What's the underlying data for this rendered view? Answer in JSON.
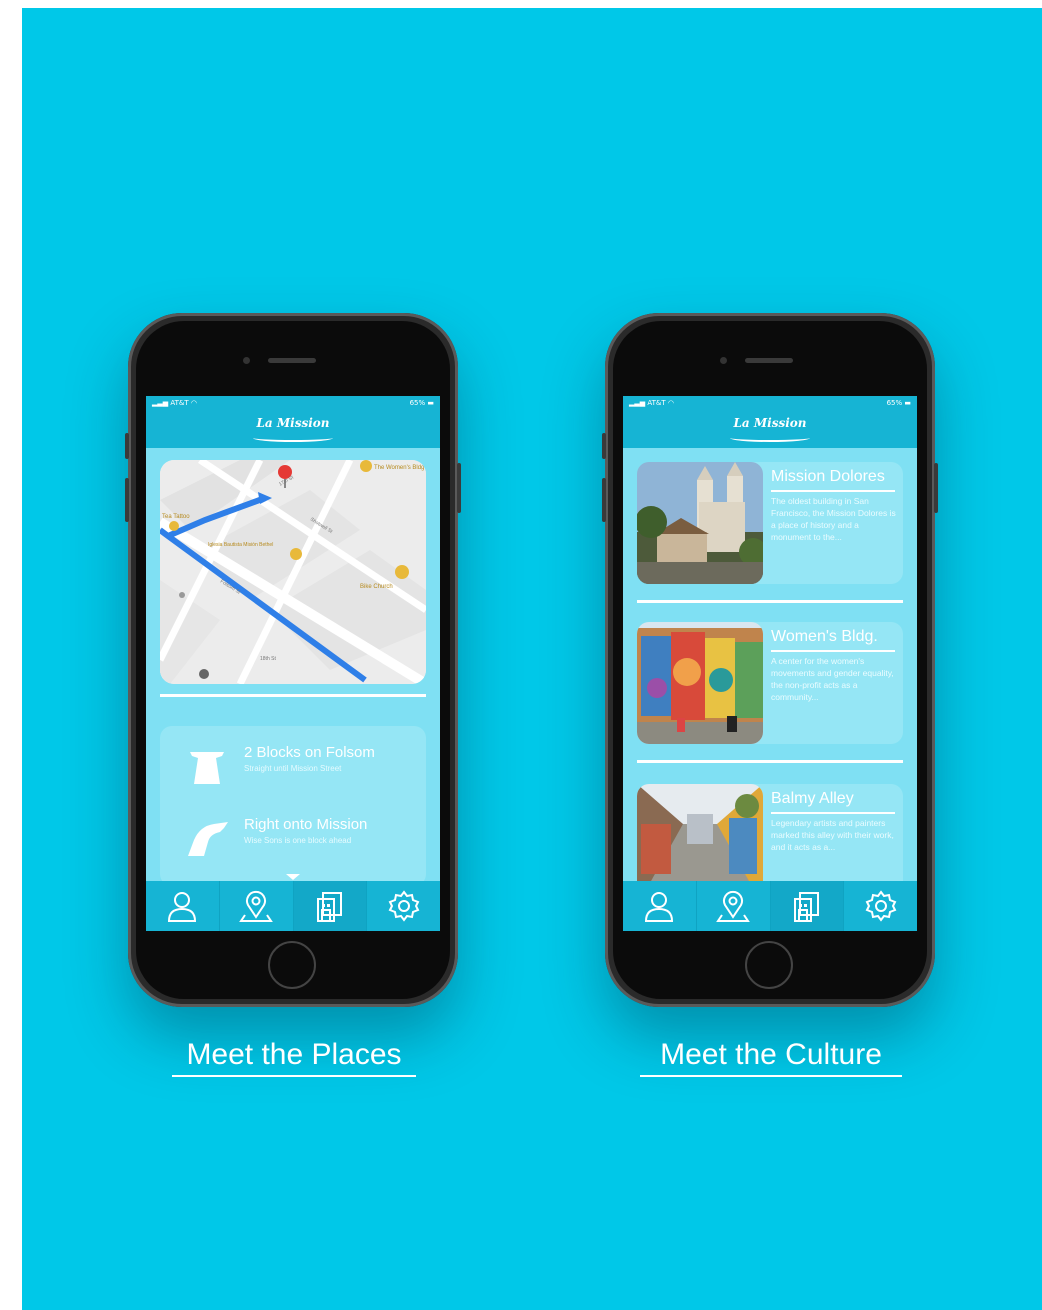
{
  "places_phone": {
    "status": {
      "carrier": "AT&T",
      "battery": "65%"
    },
    "logo": "La Mission",
    "map": {
      "labels": [
        "The Women's Bldg",
        "Tea Tattoo",
        "Iglesia Bautista Misión Bethel",
        "Bike Church",
        "17th St",
        "Folsom St",
        "Shotwell St",
        "18th St"
      ]
    },
    "directions": [
      {
        "title": "2 Blocks on Folsom",
        "subtitle": "Straight until Mission Street",
        "icon": "straight-arrow-icon"
      },
      {
        "title": "Right onto Mission",
        "subtitle": "Wise Sons is one block ahead",
        "icon": "right-turn-arrow-icon"
      }
    ],
    "caption": "Meet the Places"
  },
  "culture_phone": {
    "status": {
      "carrier": "AT&T",
      "battery": "65%"
    },
    "logo": "La Mission",
    "cards": [
      {
        "title": "Mission Dolores",
        "description": "The oldest building in San Francisco, the Mission Dolores is a place of history and a monument to the..."
      },
      {
        "title": "Women's Bldg.",
        "description": "A center for the women's movements and gender equality, the non-profit acts as a community..."
      },
      {
        "title": "Balmy Alley",
        "description": "Legendary artists and painters marked this alley with their work, and it acts as a..."
      }
    ],
    "caption": "Meet the Culture"
  },
  "nav_icons": [
    "profile-icon",
    "location-pin-icon",
    "buildings-icon",
    "settings-gear-icon"
  ],
  "colors": {
    "background": "#00c8e8",
    "app_bar": "#16b4d4",
    "screen": "#7fe0f3",
    "panel": "#95e6f5"
  }
}
